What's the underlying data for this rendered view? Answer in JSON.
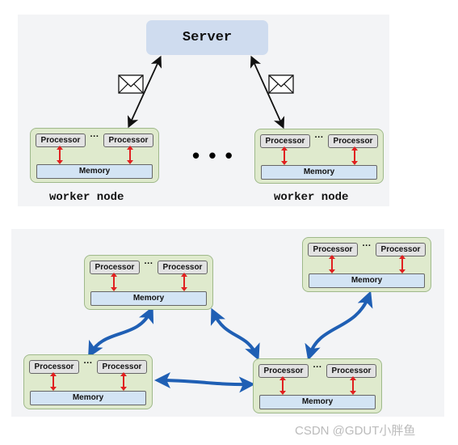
{
  "server": {
    "label": "Server"
  },
  "processor_label": "Processor",
  "memory_label": "Memory",
  "ellipsis": "···",
  "big_ellipsis": "• • •",
  "worker_label": "worker node",
  "watermark": "CSDN @GDUT小胖鱼",
  "colors": {
    "node_fill": "#dfeacd",
    "memory_fill": "#d3e4f4",
    "server_fill": "#cfdcef",
    "red_arrow": "#e02020",
    "blue_arrow": "#1f5fb4"
  }
}
